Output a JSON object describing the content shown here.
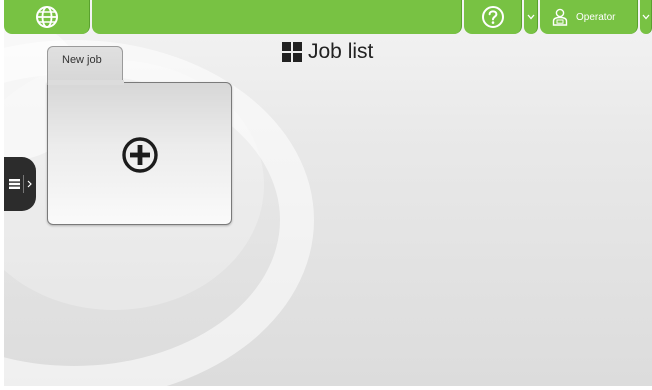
{
  "topbar": {
    "language_icon": "globe-icon",
    "help_icon": "question-circle-icon",
    "dropdown_icon": "chevron-down-icon",
    "user_icon": "operator-icon",
    "user_label": "Operator",
    "accent_color": "#78c243"
  },
  "page": {
    "title_icon": "grid-icon",
    "title": "Job list"
  },
  "side_panel": {
    "icon": "list-icon",
    "arrow_icon": "chevron-right-icon"
  },
  "jobs": {
    "new_job_label": "New job",
    "new_job_icon": "plus-circle-icon"
  }
}
